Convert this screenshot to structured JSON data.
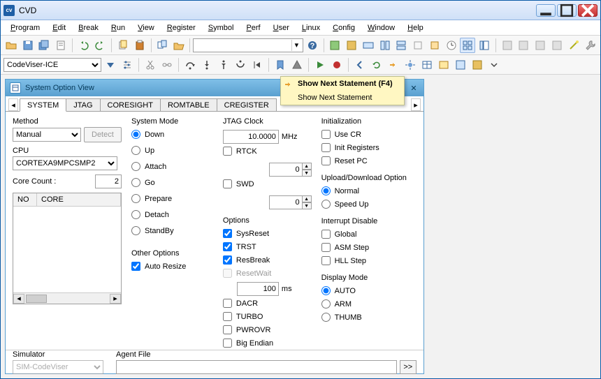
{
  "title": "CVD",
  "menubar": [
    "Program",
    "Edit",
    "Break",
    "Run",
    "View",
    "Register",
    "Symbol",
    "Perf",
    "User",
    "Linux",
    "Config",
    "Window",
    "Help"
  ],
  "toolbar2_combo": "CodeViser-ICE",
  "panel_title": "System Option View",
  "tabs": [
    "SYSTEM",
    "JTAG",
    "CORESIGHT",
    "ROMTABLE",
    "CREGISTER"
  ],
  "active_tab": 0,
  "tooltip": {
    "line1": "Show Next Statement (F4)",
    "line2": "Show Next Statement"
  },
  "col1": {
    "method_label": "Method",
    "method_value": "Manual",
    "detect": "Detect",
    "cpu_label": "CPU",
    "cpu_value": "CORTEXA9MPCSMP2",
    "core_count_label": "Core Count :",
    "core_count_value": "2",
    "tbl_h1": "NO",
    "tbl_h2": "CORE"
  },
  "system_mode": {
    "legend": "System Mode",
    "opts": [
      "Down",
      "Up",
      "Attach",
      "Go",
      "Prepare",
      "Detach",
      "StandBy"
    ],
    "selected": "Down"
  },
  "other_options": {
    "legend": "Other Options",
    "auto_resize": "Auto Resize",
    "auto_resize_checked": true
  },
  "jtag": {
    "legend": "JTAG Clock",
    "clock_value": "10.0000",
    "unit": "MHz",
    "rtck": "RTCK",
    "rtck_val": "0",
    "swd": "SWD",
    "swd_val": "0"
  },
  "options": {
    "legend": "Options",
    "sysreset": "SysReset",
    "trst": "TRST",
    "resbreak": "ResBreak",
    "resetwait": "ResetWait",
    "resetwait_val": "100",
    "ms": "ms",
    "dacr": "DACR",
    "turbo": "TURBO",
    "pwrovr": "PWROVR",
    "bigendian": "Big Endian",
    "checked": {
      "sysreset": true,
      "trst": true,
      "resbreak": true,
      "resetwait": false,
      "dacr": false,
      "turbo": false,
      "pwrovr": false,
      "bigendian": false
    }
  },
  "init": {
    "legend": "Initialization",
    "usecr": "Use CR",
    "initreg": "Init Registers",
    "resetpc": "Reset PC"
  },
  "updown": {
    "legend": "Upload/Download Option",
    "normal": "Normal",
    "speedup": "Speed Up",
    "selected": "Normal"
  },
  "intdis": {
    "legend": "Interrupt Disable",
    "global": "Global",
    "asm": "ASM Step",
    "hll": "HLL Step"
  },
  "dispmode": {
    "legend": "Display Mode",
    "opts": [
      "AUTO",
      "ARM",
      "THUMB"
    ],
    "selected": "AUTO"
  },
  "footer": {
    "sim_label": "Simulator",
    "sim_value": "SIM-CodeViser",
    "agent_label": "Agent File",
    "go": ">>"
  }
}
